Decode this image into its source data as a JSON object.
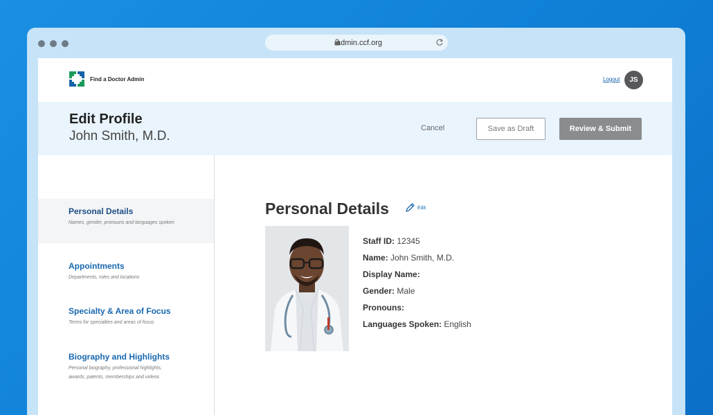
{
  "browser": {
    "url": "admin.ccf.org"
  },
  "nav": {
    "brand": "Find a Doctor Admin",
    "logout": "Logout",
    "avatar_initials": "JS"
  },
  "editbar": {
    "title": "Edit Profile",
    "name": "John Smith, M.D.",
    "cancel": "Cancel",
    "save_draft": "Save as Draft",
    "review_submit": "Review & Submit"
  },
  "sidebar": {
    "items": [
      {
        "label": "Personal Details",
        "desc": "Names, gender, pronouns and  languages spoken"
      },
      {
        "label": "Appointments",
        "desc": "Departments, roles and locations"
      },
      {
        "label": "Specialty & Area of Focus",
        "desc": "Terms for specialties and areas of focus"
      },
      {
        "label": "Biography and Highlights",
        "desc": "Personal biography, professional highlights, awards, patents, memberships and videos"
      }
    ]
  },
  "personal": {
    "title": "Personal Details",
    "edit": "Edit",
    "fields": [
      {
        "label": "Staff ID:",
        "value": "12345"
      },
      {
        "label": "Name:",
        "value": "John Smith, M.D."
      },
      {
        "label": "Display Name:",
        "value": ""
      },
      {
        "label": "Gender:",
        "value": "Male"
      },
      {
        "label": "Pronouns:",
        "value": ""
      },
      {
        "label": "Languages Spoken:",
        "value": "English"
      }
    ]
  },
  "colors": {
    "accent": "#1868b0",
    "logo_green": "#1d9a5a",
    "logo_blue": "#1763a8"
  }
}
